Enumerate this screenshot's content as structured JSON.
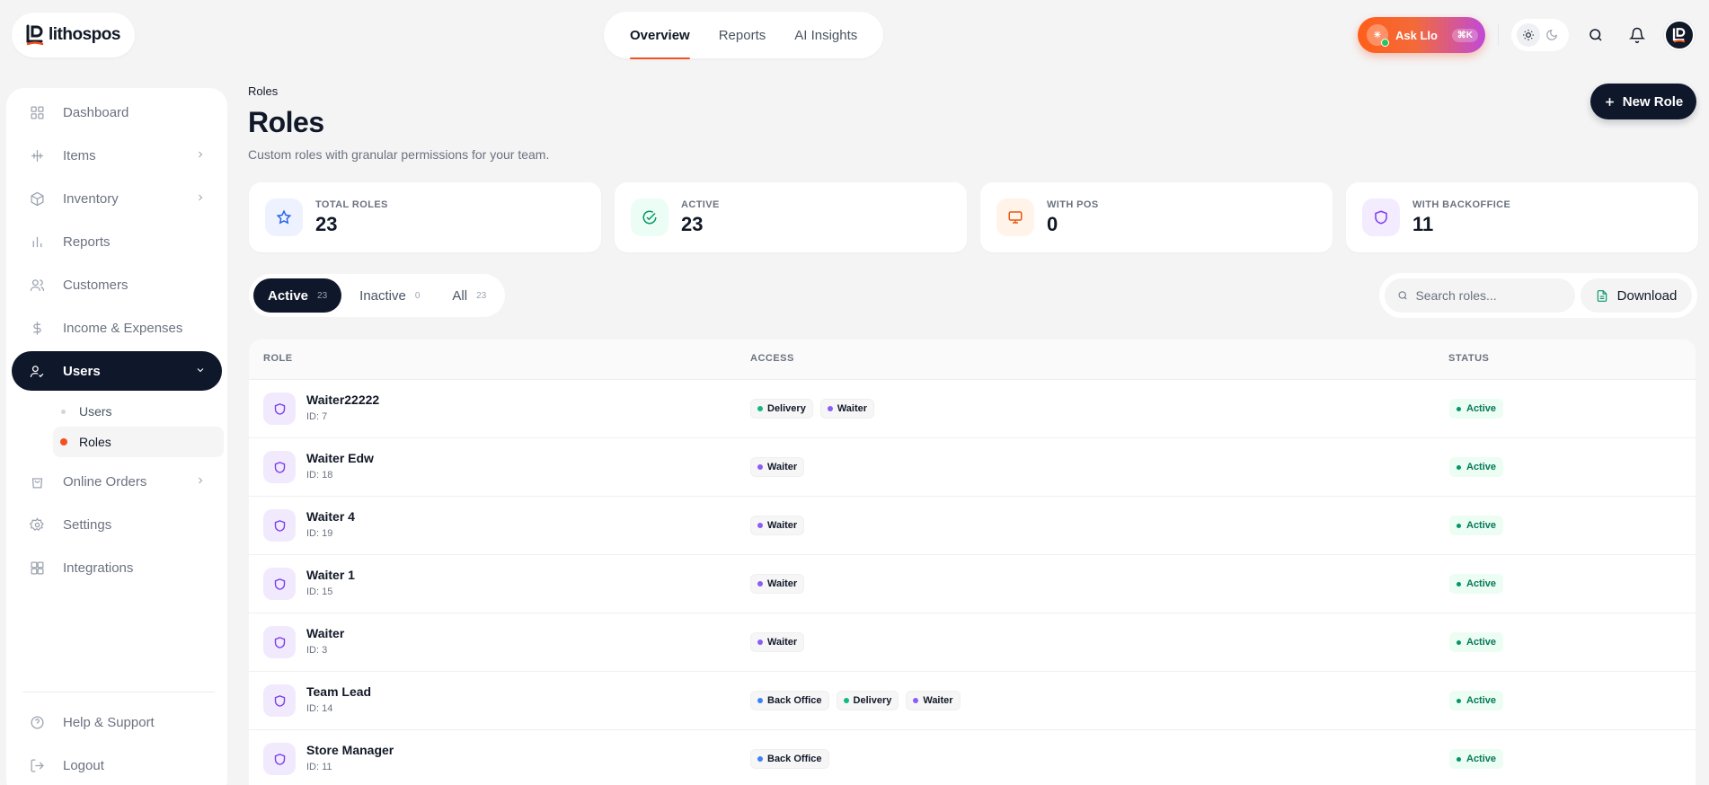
{
  "header": {
    "logo_text": "lithospos",
    "tabs": [
      "Overview",
      "Reports",
      "AI Insights"
    ],
    "ask_label": "Ask Llo",
    "ask_shortcut": "⌘K"
  },
  "sidebar": {
    "items": [
      {
        "label": "Dashboard",
        "icon": "dashboard-icon"
      },
      {
        "label": "Items",
        "icon": "items-icon"
      },
      {
        "label": "Inventory",
        "icon": "inventory-icon"
      },
      {
        "label": "Reports",
        "icon": "reports-icon"
      },
      {
        "label": "Customers",
        "icon": "customers-icon"
      },
      {
        "label": "Income & Expenses",
        "icon": "dollar-icon"
      },
      {
        "label": "Users",
        "icon": "users-icon"
      },
      {
        "label": "Online Orders",
        "icon": "shopping-bag-icon"
      },
      {
        "label": "Settings",
        "icon": "gear-icon"
      },
      {
        "label": "Integrations",
        "icon": "integrations-icon"
      }
    ],
    "sub_items": [
      "Users",
      "Roles"
    ],
    "bottom": [
      {
        "label": "Help & Support",
        "icon": "help-icon"
      },
      {
        "label": "Logout",
        "icon": "logout-icon"
      }
    ]
  },
  "main": {
    "breadcrumb": "Roles",
    "title": "Roles",
    "subtitle": "Custom roles with granular permissions for your team.",
    "new_role_label": "New Role",
    "stats": [
      {
        "label": "Total Roles",
        "value": "23",
        "icon": "star-icon",
        "color": "#2563eb",
        "bg": "#eef2ff"
      },
      {
        "label": "Active",
        "value": "23",
        "icon": "check-circle-icon",
        "color": "#059669",
        "bg": "#ecfdf5"
      },
      {
        "label": "With POS",
        "value": "0",
        "icon": "monitor-icon",
        "color": "#ea580c",
        "bg": "#fff3ea"
      },
      {
        "label": "With Backoffice",
        "value": "11",
        "icon": "shield-icon",
        "color": "#7c3aed",
        "bg": "#f3ecfe"
      }
    ],
    "filters": [
      {
        "label": "Active",
        "count": "23"
      },
      {
        "label": "Inactive",
        "count": "0"
      },
      {
        "label": "All",
        "count": "23"
      }
    ],
    "search_placeholder": "Search roles...",
    "download_label": "Download",
    "table": {
      "columns": [
        "ROLE",
        "ACCESS",
        "STATUS"
      ],
      "rows": [
        {
          "name": "Waiter22222",
          "id": "ID: 7",
          "access": [
            "Delivery",
            "Waiter"
          ],
          "status": "Active"
        },
        {
          "name": "Waiter Edw",
          "id": "ID: 18",
          "access": [
            "Waiter"
          ],
          "status": "Active"
        },
        {
          "name": "Waiter 4",
          "id": "ID: 19",
          "access": [
            "Waiter"
          ],
          "status": "Active"
        },
        {
          "name": "Waiter 1",
          "id": "ID: 15",
          "access": [
            "Waiter"
          ],
          "status": "Active"
        },
        {
          "name": "Waiter",
          "id": "ID: 3",
          "access": [
            "Waiter"
          ],
          "status": "Active"
        },
        {
          "name": "Team Lead",
          "id": "ID: 14",
          "access": [
            "Back Office",
            "Delivery",
            "Waiter"
          ],
          "status": "Active"
        },
        {
          "name": "Store Manager",
          "id": "ID: 11",
          "access": [
            "Back Office"
          ],
          "status": "Active"
        }
      ]
    },
    "access_colors": {
      "Delivery": "#10b981",
      "Waiter": "#8b5cf6",
      "Back Office": "#3b82f6"
    }
  }
}
